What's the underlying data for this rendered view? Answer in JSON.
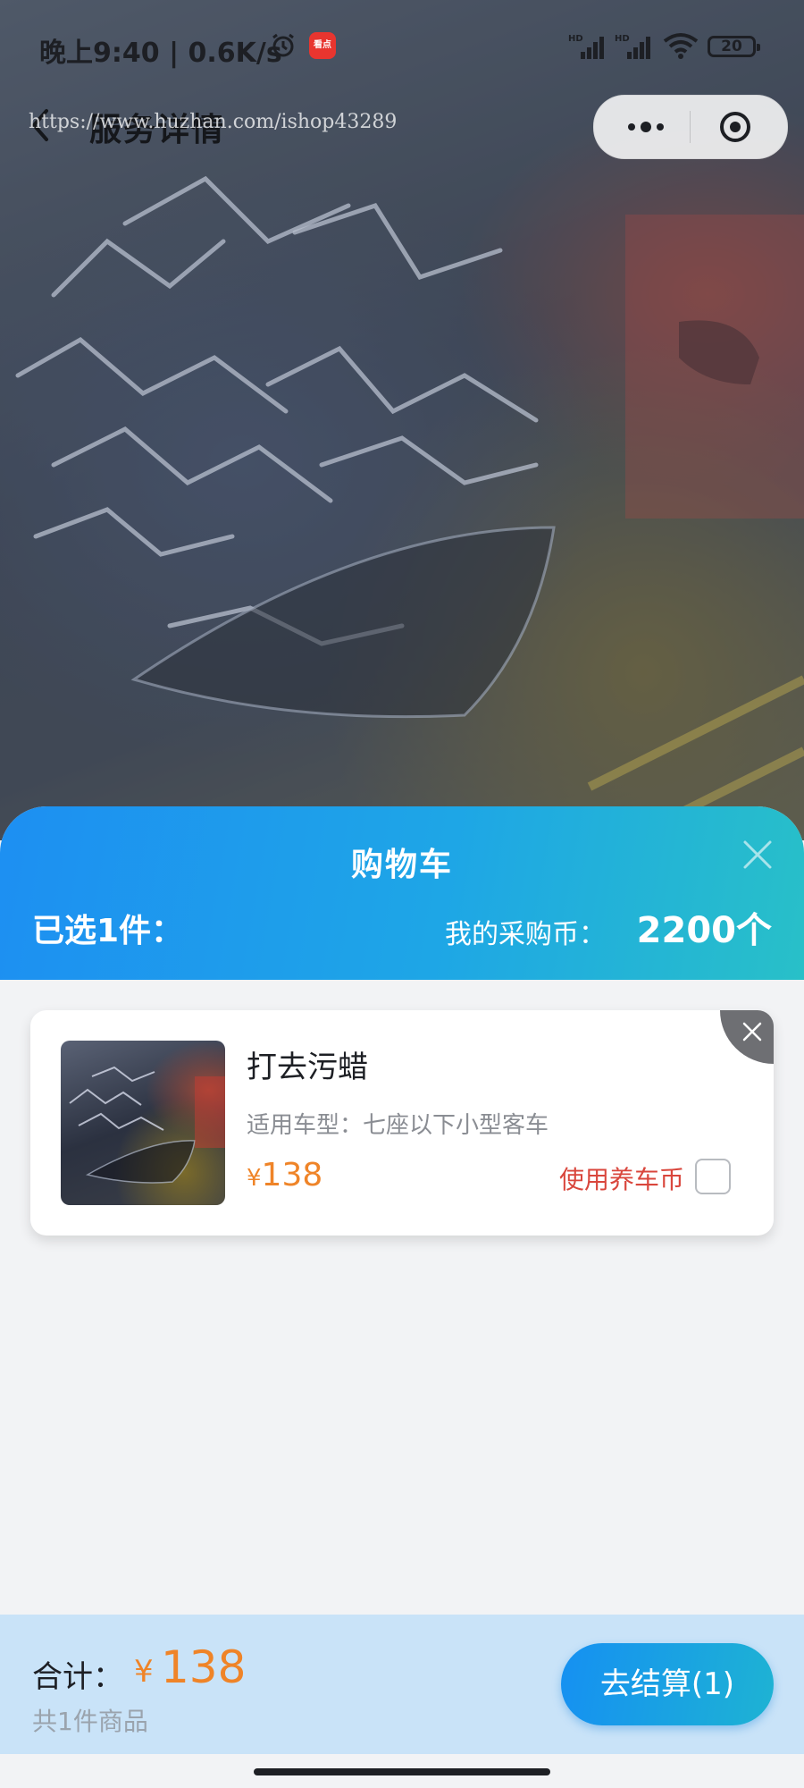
{
  "status_bar": {
    "time": "晚上9:40 | 0.6K/s",
    "app_badge": "看点",
    "battery": "20"
  },
  "nav": {
    "title": "服务详情",
    "watermark": "https://www.huzhan.com/ishop43289"
  },
  "cart": {
    "title": "购物车",
    "selected": "已选1件：",
    "coins_label": "我的采购币：",
    "coins_value": "2200个",
    "items": [
      {
        "name": "打去污蜡",
        "spec": "适用车型：七座以下小型客车",
        "price_symbol": "¥",
        "price": "138",
        "use_coin_label": "使用养车币",
        "use_coin_checked": false
      }
    ]
  },
  "footer": {
    "total_label": "合计：",
    "currency": "¥",
    "total": "138",
    "count_text": "共1件商品",
    "checkout_label": "去结算(1)"
  },
  "colors": {
    "accent_blue": "#1d8ff2",
    "accent_teal": "#28c0c8",
    "price_orange": "#ef8428",
    "coin_red": "#d9463c"
  }
}
